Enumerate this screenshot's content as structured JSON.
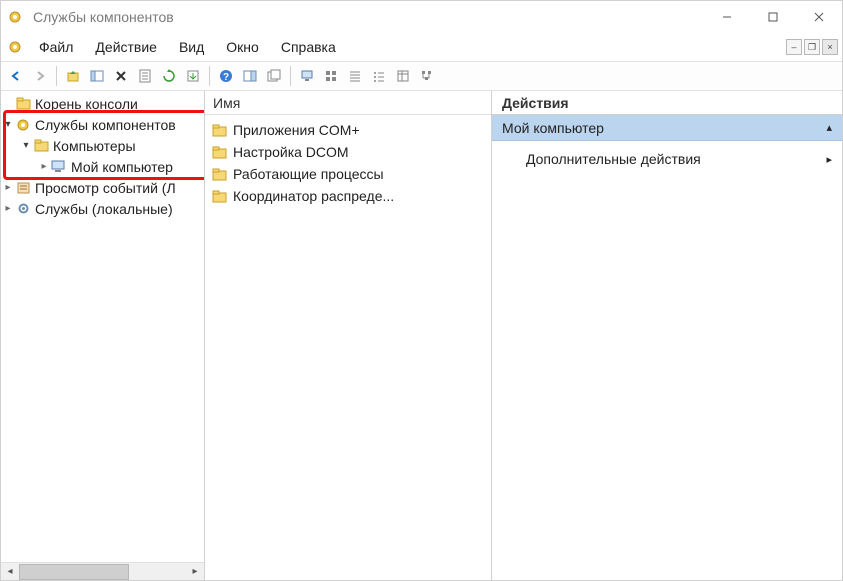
{
  "titlebar": {
    "title": "Службы компонентов"
  },
  "menu": {
    "file": "Файл",
    "action": "Действие",
    "view": "Вид",
    "window": "Окно",
    "help": "Справка"
  },
  "tree": {
    "root": "Корень консоли",
    "services_components": "Службы компонентов",
    "computers": "Компьютеры",
    "my_computer": "Мой компьютер",
    "event_viewer": "Просмотр событий (Л",
    "services_local": "Службы (локальные)"
  },
  "list": {
    "header": "Имя",
    "items": [
      "Приложения COM+",
      "Настройка DCOM",
      "Работающие процессы",
      "Координатор распреде..."
    ]
  },
  "actions": {
    "header": "Действия",
    "section": "Мой компьютер",
    "more": "Дополнительные действия"
  }
}
